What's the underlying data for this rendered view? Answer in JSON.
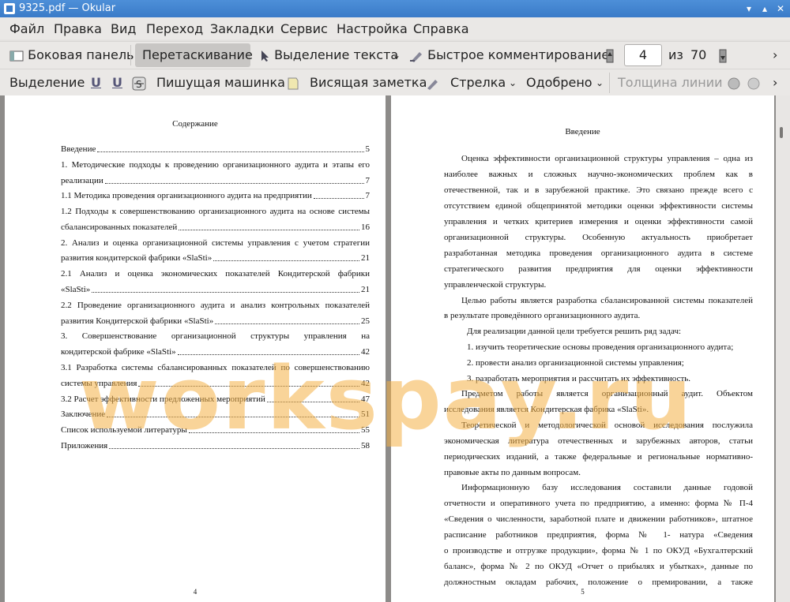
{
  "window": {
    "title": "9325.pdf  — Okular"
  },
  "menu": [
    "Файл",
    "Правка",
    "Вид",
    "Переход",
    "Закладки",
    "Сервис",
    "Настройка",
    "Справка"
  ],
  "toolbar": {
    "sidebar": "Боковая панель",
    "drag": "Перетаскивание",
    "text_select": "Выделение текста",
    "quick_comment": "Быстрое комментирование",
    "page_current": "4",
    "page_of": "из",
    "page_total": "70"
  },
  "annotbar": {
    "highlight": "Выделение",
    "typewriter": "Пишущая машинка",
    "note": "Висящая заметка",
    "arrow": "Стрелка",
    "stamp": "Одобрено",
    "line_width": "Толщина линии"
  },
  "left_page": {
    "title": "Содержание",
    "number": "4",
    "toc": [
      {
        "text": "Введение",
        "page": "5"
      },
      {
        "text": "1. Методические подходы к проведению организационного аудита и этапы его",
        "cont": "реализации",
        "page": "7"
      },
      {
        "text": "1.1 Методика проведения организационного аудита на предприятии",
        "page": "7"
      },
      {
        "text": "1.2 Подходы к совершенствованию организационного аудита на основе системы",
        "cont": "сбалансированных показателей",
        "page": "16"
      },
      {
        "text": "2. Анализ и оценка организационной системы управления с учетом стратегии",
        "cont": "развития кондитерской фабрики «SlaSti»",
        "page": "21"
      },
      {
        "text": "2.1 Анализ и оценка экономических показателей Кондитерской фабрики",
        "cont": "«SlaSti»",
        "page": "21"
      },
      {
        "text": "2.2 Проведение организационного аудита и анализ контрольных показателей",
        "cont": "развития Кондитерской фабрики «SlaSti»",
        "page": "25"
      },
      {
        "text": "3. Совершенствование организационной структуры управления на",
        "cont": "кондитерской фабрике «SlaSti»",
        "page": "42"
      },
      {
        "text": "3.1 Разработка системы сбалансированных показателей по совершенствованию",
        "cont": "системы управления",
        "page": "42"
      },
      {
        "text": "3.2 Расчет эффективности предложенных мероприятий",
        "page": "47"
      },
      {
        "text": "Заключение",
        "page": "51"
      },
      {
        "text": "Список используемой литературы",
        "page": "55"
      },
      {
        "text": "Приложения",
        "page": "58"
      }
    ]
  },
  "right_page": {
    "title": "Введение",
    "number": "5",
    "lines": [
      "Оценка эффективности организационной структуры управления – одна из",
      "наиболее важных и сложных научно-экономических проблем как в",
      "отечественной, так и в зарубежной практике. Это связано прежде всего с",
      "отсутствием единой общепринятой методики оценки эффективности системы",
      "управления и четких критериев измерения и оценки эффективности самой",
      "организационной структуры. Особенную актуальность приобретает",
      "разработанная методика проведения организационного аудита в системе",
      "стратегического развития предприятия для оценки эффективности",
      "управленческой структуры.",
      "Целью работы является разработка сбалансированной системы показателей",
      "в результате проведённого организационного аудита.",
      "Для реализации данной цели требуется решить ряд задач:",
      "1. изучить теоретические основы проведения организационного аудита;",
      "2. провести анализ организационной системы управления;",
      "3. разработать мероприятия и рассчитать их эффективность.",
      "Предметом работы является организационный аудит. Объектом",
      "исследования является Кондитерская фабрика «SlaSti».",
      "Теоретической и методологической основой исследования послужила",
      "экономическая литература отечественных и зарубежных авторов, статьи",
      "периодических изданий, а также федеральные и региональные нормативно-",
      "правовые акты по данным вопросам.",
      "Информационную базу исследования составили данные годовой",
      "отчетности и оперативного учета по предприятию, а именно: форма № П-4",
      "«Сведения о численности, заработной плате и движении работников», штатное",
      "расписание работников предприятия, форма № 1- натура «Сведения",
      "о производстве и отгрузке продукции», форма № 1 по ОКУД «Бухгалтерский",
      "баланс», форма № 2 по ОКУД «Отчет о прибылях и убытках», данные по",
      "должностным окладам рабочих, положение о премировании, а также"
    ]
  },
  "watermark": "workspay.ru"
}
